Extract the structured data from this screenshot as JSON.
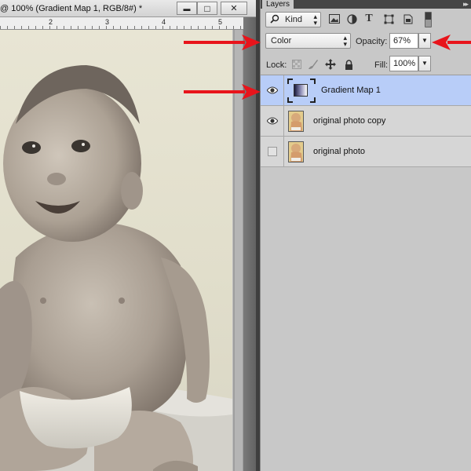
{
  "document": {
    "title": "@ 100% (Gradient Map 1, RGB/8#) *",
    "minimize_symbol": "▬",
    "maximize_symbol": "□",
    "close_symbol": "✕",
    "ruler_numbers": [
      "2",
      "3",
      "4",
      "5"
    ]
  },
  "layers_panel": {
    "tab_label": "Layers",
    "collapse_symbol": "▸▸",
    "filter": {
      "kind_label": "Kind",
      "search_icon": "search-icon",
      "icons": [
        "image-filter-icon",
        "adjustment-filter-icon",
        "type-filter-icon",
        "shape-filter-icon",
        "smart-object-filter-icon"
      ]
    },
    "blend_mode": "Color",
    "opacity_label": "Opacity:",
    "opacity_value": "67%",
    "lock_label": "Lock:",
    "fill_label": "Fill:",
    "fill_value": "100%",
    "layers": [
      {
        "name": "Gradient Map 1",
        "visible": true,
        "selected": true,
        "type": "gradient-map-adjustment"
      },
      {
        "name": "original photo copy",
        "visible": true,
        "selected": false,
        "type": "image"
      },
      {
        "name": "original photo",
        "visible": false,
        "selected": false,
        "type": "image"
      }
    ]
  },
  "colors": {
    "selection": "#b8cdf8",
    "annotation_arrow": "#e8141b",
    "panel_bg": "#c8c8c8"
  }
}
